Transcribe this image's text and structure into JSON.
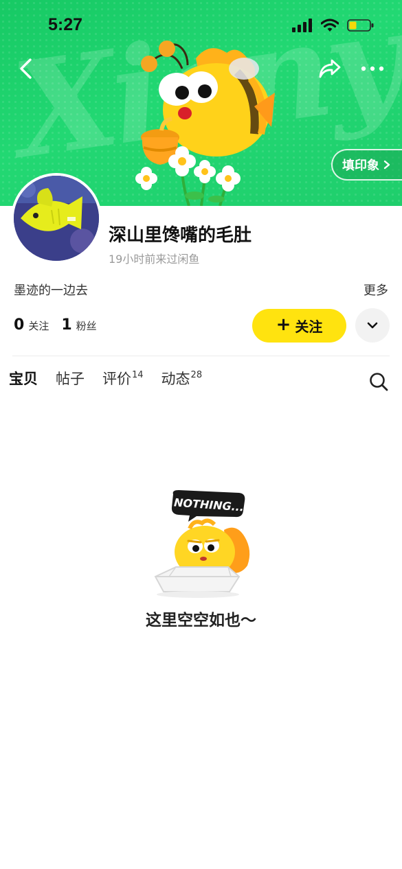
{
  "status_bar": {
    "time": "5:27",
    "battery_color": "#f5d90a"
  },
  "banner": {
    "watermark_text": "Xianyu",
    "impression_button_label": "填印象",
    "gradient_start": "#17c964",
    "gradient_end": "#1fce6c"
  },
  "profile": {
    "username": "深山里馋嘴的毛肚",
    "last_seen": "19小时前来过闲鱼",
    "bio": "墨迹的一边去",
    "more_label": "更多",
    "stats": [
      {
        "value": "0",
        "label": "关注"
      },
      {
        "value": "1",
        "label": "粉丝"
      }
    ],
    "follow_button_label": "关注",
    "follow_button_icon": "+",
    "accent_color": "#ffe30f"
  },
  "tabs": [
    {
      "label": "宝贝",
      "count": "",
      "active": true
    },
    {
      "label": "帖子",
      "count": "",
      "active": false
    },
    {
      "label": "评价",
      "count": "14",
      "active": false
    },
    {
      "label": "动态",
      "count": "28",
      "active": false
    }
  ],
  "empty_state": {
    "badge_text": "NOTHING...",
    "message": "这里空空如也～"
  },
  "icons": {
    "back": "chevron-left-icon",
    "share": "share-icon",
    "more": "ellipsis-icon",
    "dropdown": "chevron-down-icon",
    "search": "search-icon"
  }
}
